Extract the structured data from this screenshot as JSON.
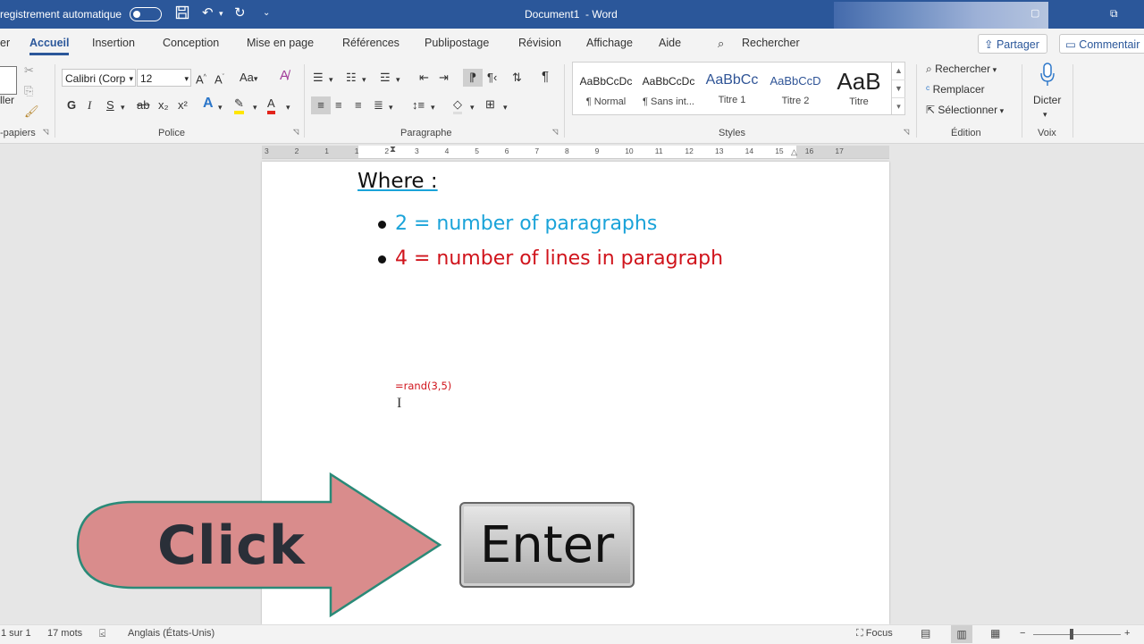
{
  "titlebar": {
    "autosave_label": "registrement automatique",
    "doc_title": "Document1",
    "separator": "-",
    "app_name": "Word"
  },
  "tabs": [
    "er",
    "Accueil",
    "Insertion",
    "Conception",
    "Mise en page",
    "Références",
    "Publipostage",
    "Révision",
    "Affichage",
    "Aide"
  ],
  "active_tab": "Accueil",
  "search_label": "Rechercher",
  "share_label": "Partager",
  "comments_label": "Commentair",
  "ribbon": {
    "clipboard": {
      "paste_label": "ller",
      "group_label": "-papiers"
    },
    "font": {
      "name": "Calibri (Corp",
      "size": "12",
      "bold": "G",
      "italic": "I",
      "underline": "S",
      "strike": "ab",
      "subscript": "x₂",
      "superscript": "x²",
      "group_label": "Police"
    },
    "paragraph": {
      "group_label": "Paragraphe"
    },
    "styles": {
      "items": [
        {
          "preview": "AaBbCcDc",
          "name": "¶ Normal"
        },
        {
          "preview": "AaBbCcDc",
          "name": "¶ Sans int..."
        },
        {
          "preview": "AaBbCc",
          "name": "Titre 1"
        },
        {
          "preview": "AaBbCcD",
          "name": "Titre 2"
        },
        {
          "preview": "AaB",
          "name": "Titre"
        }
      ],
      "group_label": "Styles"
    },
    "editing": {
      "find": "Rechercher",
      "replace": "Remplacer",
      "select": "Sélectionner",
      "group_label": "Édition"
    },
    "voice": {
      "dictate": "Dicter",
      "group_label": "Voix"
    }
  },
  "ruler_numbers": [
    "3",
    "2",
    "1",
    "1",
    "2",
    "3",
    "4",
    "5",
    "6",
    "7",
    "8",
    "9",
    "10",
    "11",
    "12",
    "13",
    "14",
    "15",
    "16",
    "17"
  ],
  "document": {
    "heading": "Where :",
    "bullets": [
      {
        "text": "2 = number of paragraphs",
        "color": "#1aa3d9"
      },
      {
        "text": "4 = number of lines in paragraph",
        "color": "#d0141c"
      }
    ],
    "formula": "=rand(3,5)"
  },
  "overlay": {
    "click_label": "Click",
    "enter_label": "Enter",
    "arrow_color": "#d98c8c",
    "arrow_border": "#2a8a78"
  },
  "statusbar": {
    "page": "1 sur 1",
    "words": "17 mots",
    "language": "Anglais (États-Unis)",
    "focus": "Focus"
  },
  "accent": "#2b579a"
}
